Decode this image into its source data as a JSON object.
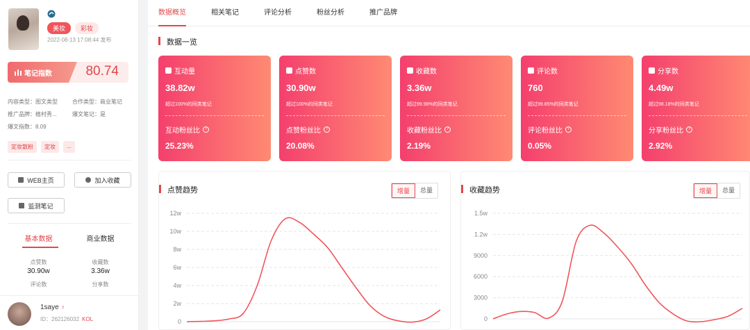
{
  "note": {
    "tags": [
      "美妆",
      "彩妆"
    ],
    "publish_time": "2022-08-13 17:08:44 发布",
    "score_label": "笔记指数",
    "score_value": "80.74",
    "meta": {
      "content_type": "内容类型：图文类型",
      "coop_type": "合作类型：商业笔记",
      "brand": "推广品牌：植村秀...",
      "viral": "爆文笔记：是",
      "viral_index": "爆文指数：8.09"
    },
    "chips": [
      "定妆散粉",
      "定妆",
      "..."
    ],
    "buttons": {
      "web": "WEB主页",
      "favorite": "加入收藏",
      "monitor": "监测笔记"
    },
    "left_tabs": [
      "基本数据",
      "商业数据"
    ],
    "stats": [
      {
        "label": "点赞数",
        "value": "30.90w"
      },
      {
        "label": "收藏数",
        "value": "3.36w"
      },
      {
        "label": "评论数",
        "value": ""
      },
      {
        "label": "分享数",
        "value": ""
      }
    ],
    "author": {
      "name": "1saye",
      "id": "ID：262126032",
      "badge": "KOL"
    }
  },
  "tabs": [
    "数据概览",
    "相关笔记",
    "评论分析",
    "粉丝分析",
    "推广品牌"
  ],
  "overview_title": "数据一览",
  "cards": [
    {
      "title": "互动量",
      "value": "38.82w",
      "sub": "超过100%的同类笔记",
      "ratio_label": "互动粉丝比",
      "ratio": "25.23%"
    },
    {
      "title": "点赞数",
      "value": "30.90w",
      "sub": "超过100%的同类笔记",
      "ratio_label": "点赞粉丝比",
      "ratio": "20.08%"
    },
    {
      "title": "收藏数",
      "value": "3.36w",
      "sub": "超过99.98%的同类笔记",
      "ratio_label": "收藏粉丝比",
      "ratio": "2.19%"
    },
    {
      "title": "评论数",
      "value": "760",
      "sub": "超过99.85%的同类笔记",
      "ratio_label": "评论粉丝比",
      "ratio": "0.05%"
    },
    {
      "title": "分享数",
      "value": "4.49w",
      "sub": "超过98.18%的同类笔记",
      "ratio_label": "分享粉丝比",
      "ratio": "2.92%"
    }
  ],
  "toggle": [
    "增量",
    "总量"
  ],
  "colors": {
    "accent": "#e0484d",
    "card_start": "#f43f6d",
    "card_end": "#ff8a73",
    "line": "#f0555a"
  },
  "chart_data": [
    {
      "type": "line",
      "title": "点赞趋势",
      "y_ticks": [
        "0",
        "2w",
        "4w",
        "6w",
        "8w",
        "10w",
        "12w"
      ],
      "ylim": [
        0,
        120000
      ],
      "x": [
        0,
        1,
        2,
        3,
        4,
        5,
        6,
        7,
        8,
        9,
        10,
        11,
        12,
        13,
        14,
        15,
        16,
        17,
        18
      ],
      "series": [
        {
          "values": [
            0,
            300,
            1000,
            3000,
            9000,
            40000,
            90000,
            114000,
            110000,
            97000,
            82000,
            60000,
            38000,
            18000,
            6000,
            1000,
            -500,
            3000,
            13000
          ]
        }
      ]
    },
    {
      "type": "line",
      "title": "收藏趋势",
      "y_ticks": [
        "0",
        "3000",
        "6000",
        "9000",
        "1.2w",
        "1.5w"
      ],
      "ylim": [
        0,
        15000
      ],
      "x": [
        0,
        1,
        2,
        3,
        4,
        5,
        6,
        7,
        8,
        9,
        10,
        11,
        12,
        13,
        14,
        15,
        16,
        17,
        18
      ],
      "series": [
        {
          "values": [
            0,
            700,
            1050,
            900,
            100,
            2500,
            11000,
            13300,
            12200,
            10200,
            7800,
            4800,
            2300,
            700,
            -300,
            -400,
            -100,
            400,
            1500
          ]
        }
      ]
    }
  ]
}
